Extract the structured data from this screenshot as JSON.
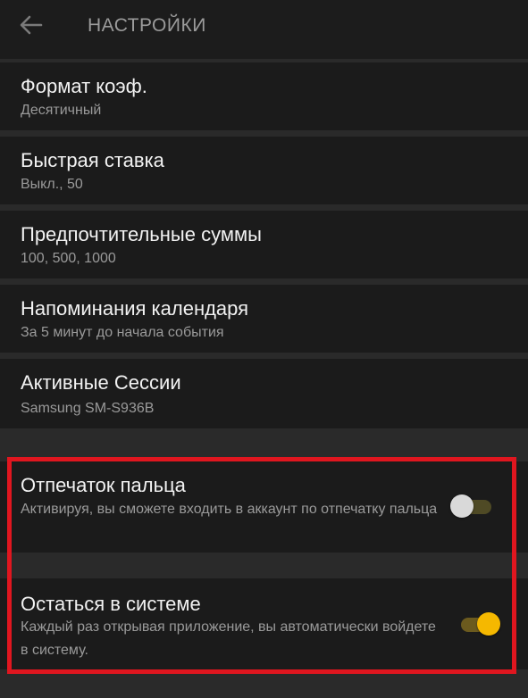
{
  "appbar": {
    "title": "НАСТРОЙКИ",
    "back_icon": "arrow-left-icon"
  },
  "settings": [
    {
      "id": "odds-format",
      "title": "Формат коэф.",
      "subtitle": "Десятичный"
    },
    {
      "id": "quick-bet",
      "title": "Быстрая ставка",
      "subtitle": "Выкл., 50"
    },
    {
      "id": "preferred-amounts",
      "title": "Предпочтительные суммы",
      "subtitle": "100, 500, 1000"
    },
    {
      "id": "calendar-reminders",
      "title": "Напоминания календаря",
      "subtitle": "За 5 минут до начала события"
    },
    {
      "id": "active-sessions",
      "title": "Активные Сессии",
      "subtitle": "Samsung SM-S936B"
    }
  ],
  "security": [
    {
      "id": "fingerprint",
      "title": "Отпечаток пальца",
      "subtitle": "Активируя, вы сможете входить в аккаунт по отпечатку пальца",
      "enabled": false
    },
    {
      "id": "stay-signed-in",
      "title": "Остаться в системе",
      "subtitle": "Каждый раз открывая приложение, вы автоматически войдете в систему.",
      "enabled": true
    }
  ],
  "colors": {
    "accent": "#f5b800",
    "highlight": "#e0161f",
    "toggle_off_thumb": "#d9d9d9",
    "toggle_off_track": "#4a4a2a",
    "toggle_on_track": "#6b5a1e"
  }
}
